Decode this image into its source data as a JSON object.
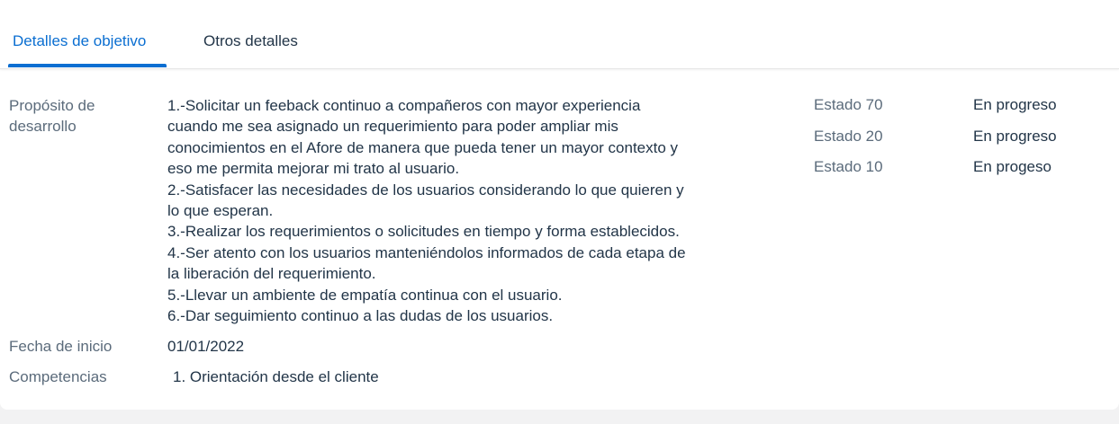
{
  "tabs": [
    {
      "label": "Detalles de objetivo",
      "active": true
    },
    {
      "label": "Otros detalles",
      "active": false
    }
  ],
  "colors": {
    "accent": "#0a6ed1",
    "text": "#223548",
    "label": "#5b6b7b",
    "background": "#f2f2f3",
    "card": "#ffffff"
  },
  "details": {
    "purpose": {
      "label_line1": "Propósito de",
      "label_line2": "desarrollo",
      "lines": [
        "1.-Solicitar un feeback continuo a compañeros con mayor experiencia",
        "cuando me sea asignado un requerimiento para poder ampliar mis",
        "conocimientos en el Afore de manera que pueda tener un mayor contexto y",
        "eso me permita mejorar mi trato al usuario.",
        "2.-Satisfacer las necesidades de los usuarios considerando lo que quieren y",
        "lo que esperan.",
        "3.-Realizar los requerimientos o solicitudes en tiempo y forma establecidos.",
        "4.-Ser atento con los usuarios manteniéndolos informados de cada etapa de",
        "la liberación del requerimiento.",
        "5.-Llevar un ambiente de empatía continua con el usuario.",
        "6.-Dar seguimiento continuo a las dudas de los usuarios."
      ]
    },
    "start_date": {
      "label": "Fecha de inicio",
      "value": "01/01/2022"
    },
    "competencies": {
      "label": "Competencias",
      "value": "1. Orientación desde el cliente"
    }
  },
  "statuses": [
    {
      "label": "Estado 70",
      "value": "En progreso"
    },
    {
      "label": "Estado 20",
      "value": "En progreso"
    },
    {
      "label": "Estado 10",
      "value": "En progeso"
    }
  ]
}
